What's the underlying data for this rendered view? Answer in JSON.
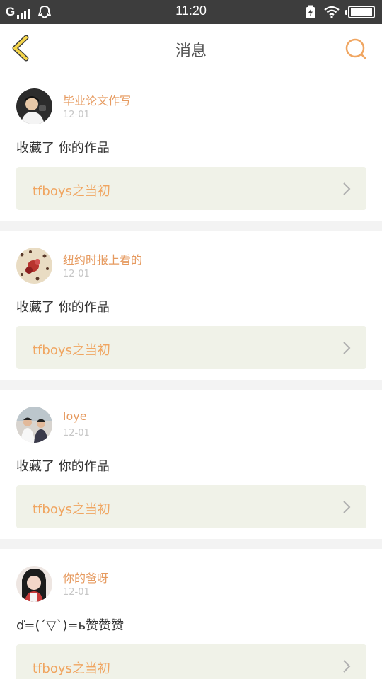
{
  "status_bar": {
    "carrier": "G",
    "time": "11:20",
    "icons": [
      "signal-icon",
      "qq-icon",
      "charging-icon",
      "wifi-icon",
      "battery-icon"
    ]
  },
  "header": {
    "title": "消息",
    "back_icon": "chevron-left-icon",
    "search_icon": "search-icon",
    "accent_color": "#f0a560",
    "back_color": "#f5d54a"
  },
  "notifications": [
    {
      "username": "毕业论文作写",
      "time": "12-01",
      "message": "收藏了 你的作品",
      "work_title": "tfboys之当初"
    },
    {
      "username": "纽约时报上看的",
      "time": "12-01",
      "message": "收藏了 你的作品",
      "work_title": "tfboys之当初"
    },
    {
      "username": "loye",
      "time": "12-01",
      "message": "收藏了 你的作品",
      "work_title": "tfboys之当初"
    },
    {
      "username": "你的爸呀",
      "time": "12-01",
      "message": "ď=(´▽`)=ь赞赞赞",
      "work_title": "tfboys之当初"
    }
  ]
}
